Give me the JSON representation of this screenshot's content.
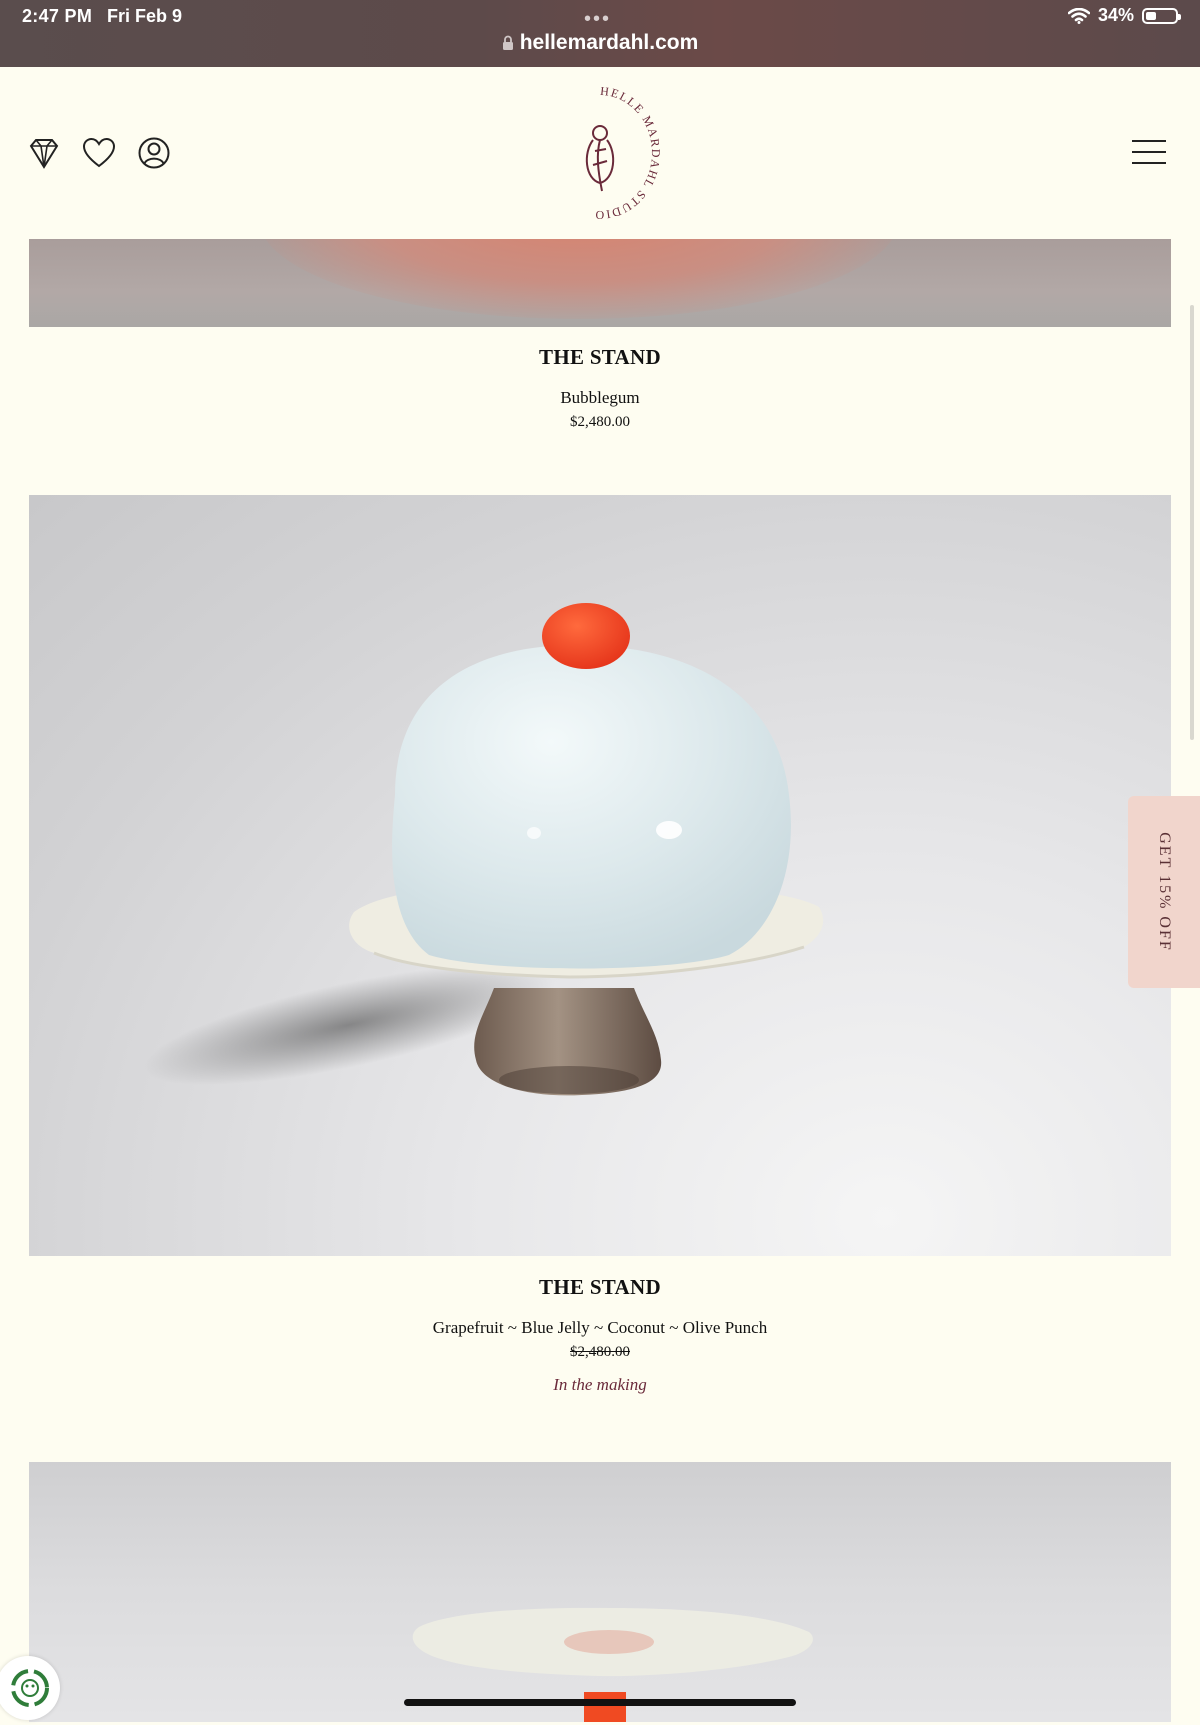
{
  "status_bar": {
    "time": "2:47 PM",
    "date": "Fri Feb 9",
    "battery": "34%",
    "battery_level": 0.34,
    "url": "hellemardahl.com"
  },
  "header": {
    "logo_text_top": "HELLE MARDAHL STUDIO",
    "logo_text_bottom": "HELLE MARDAHL STUDIO",
    "icons": [
      "diamond-icon",
      "heart-icon",
      "user-icon",
      "menu-icon"
    ]
  },
  "products": [
    {
      "title": "THE STAND",
      "variant": "Bubblegum",
      "price": "$2,480.00",
      "price_struck": false
    },
    {
      "title": "THE STAND",
      "variant": "Grapefruit ~ Blue Jelly ~ Coconut ~ Olive Punch",
      "price": "$2,480.00",
      "price_struck": true,
      "status": "In the making"
    }
  ],
  "promo": {
    "label": "GET 15% OFF"
  },
  "colors": {
    "background": "#fefdf1",
    "brand": "#6a2a3a",
    "promo": "#f1d5cc"
  }
}
